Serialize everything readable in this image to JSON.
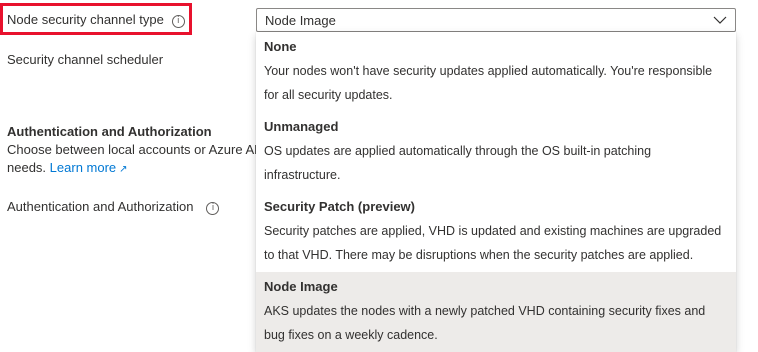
{
  "form": {
    "node_security_channel_type_label": "Node security channel type",
    "security_channel_scheduler_label": "Security channel scheduler",
    "auth_section_title": "Authentication and Authorization",
    "auth_section_desc_line1": "Choose between local accounts or Azure AD",
    "auth_section_desc_line2_prefix": "needs.",
    "learn_more_link": "Learn more",
    "auth_label": "Authentication and Authorization",
    "info_icon_glyph": "i"
  },
  "select": {
    "selected_value": "Node Image",
    "chevron_glyph": "⌵"
  },
  "dropdown": {
    "options": [
      {
        "title": "None",
        "desc_line1": "Your nodes won't have security updates applied automatically. You're responsible",
        "desc_line2": "for all security updates.",
        "selected": false
      },
      {
        "title": "Unmanaged",
        "desc_line1": "OS updates are applied automatically through the OS built-in patching",
        "desc_line2": "infrastructure.",
        "selected": false
      },
      {
        "title": "Security Patch (preview)",
        "desc_line1": "Security patches are applied, VHD is updated and existing machines are upgraded",
        "desc_line2": "to that VHD. There may be disruptions when the security patches are applied.",
        "selected": false
      },
      {
        "title": "Node Image",
        "desc_line1": "AKS updates the nodes with a newly patched VHD containing security fixes and",
        "desc_line2": "bug fixes on a weekly cadence.",
        "selected": true
      }
    ]
  },
  "colors": {
    "highlight_border": "#e8112d",
    "link": "#0078d4",
    "selected_option_bg": "#edebe9",
    "text": "#323130"
  }
}
